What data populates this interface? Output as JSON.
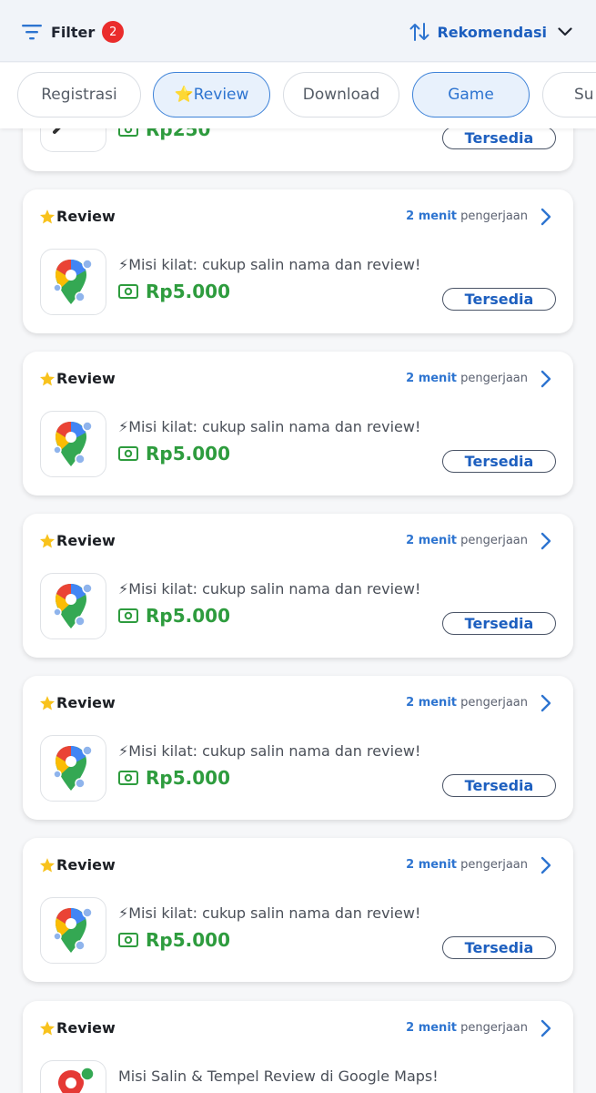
{
  "header": {
    "filter_label": "Filter",
    "filter_count": "2",
    "sort_label": "Rekomendasi"
  },
  "categories": [
    {
      "label": "Registrasi",
      "active": false
    },
    {
      "label": "⭐Review",
      "active": true
    },
    {
      "label": "Download",
      "active": false
    },
    {
      "label": "Game",
      "active": true
    },
    {
      "label": "Su",
      "active": false
    }
  ],
  "partial_card": {
    "reward": "Rp250",
    "status": "Tersedia"
  },
  "tasks": [
    {
      "title": "Review",
      "duration_value": "2 menit",
      "duration_suffix": "pengerjaan",
      "description": "⚡Misi kilat: cukup salin nama dan review!",
      "reward": "Rp5.000",
      "status": "Tersedia"
    },
    {
      "title": "Review",
      "duration_value": "2 menit",
      "duration_suffix": "pengerjaan",
      "description": "⚡Misi kilat: cukup salin nama dan review!",
      "reward": "Rp5.000",
      "status": "Tersedia"
    },
    {
      "title": "Review",
      "duration_value": "2 menit",
      "duration_suffix": "pengerjaan",
      "description": "⚡Misi kilat: cukup salin nama dan review!",
      "reward": "Rp5.000",
      "status": "Tersedia"
    },
    {
      "title": "Review",
      "duration_value": "2 menit",
      "duration_suffix": "pengerjaan",
      "description": "⚡Misi kilat: cukup salin nama dan review!",
      "reward": "Rp5.000",
      "status": "Tersedia"
    },
    {
      "title": "Review",
      "duration_value": "2 menit",
      "duration_suffix": "pengerjaan",
      "description": "⚡Misi kilat: cukup salin nama dan review!",
      "reward": "Rp5.000",
      "status": "Tersedia"
    },
    {
      "title": "Review",
      "duration_value": "2 menit",
      "duration_suffix": "pengerjaan",
      "description": "Misi Salin & Tempel Review di Google Maps!",
      "reward": "",
      "status": ""
    }
  ],
  "colors": {
    "accent": "#2d74d0",
    "reward_green": "#2e9c3e",
    "badge_red": "#ea2c2c"
  },
  "icons": {
    "filter": "filter-lines-icon",
    "sort": "sort-arrows-icon",
    "title": "star-icon",
    "reward": "money-icon",
    "app": "google-maps-pin-icon",
    "more": "chevron-right-icon"
  }
}
